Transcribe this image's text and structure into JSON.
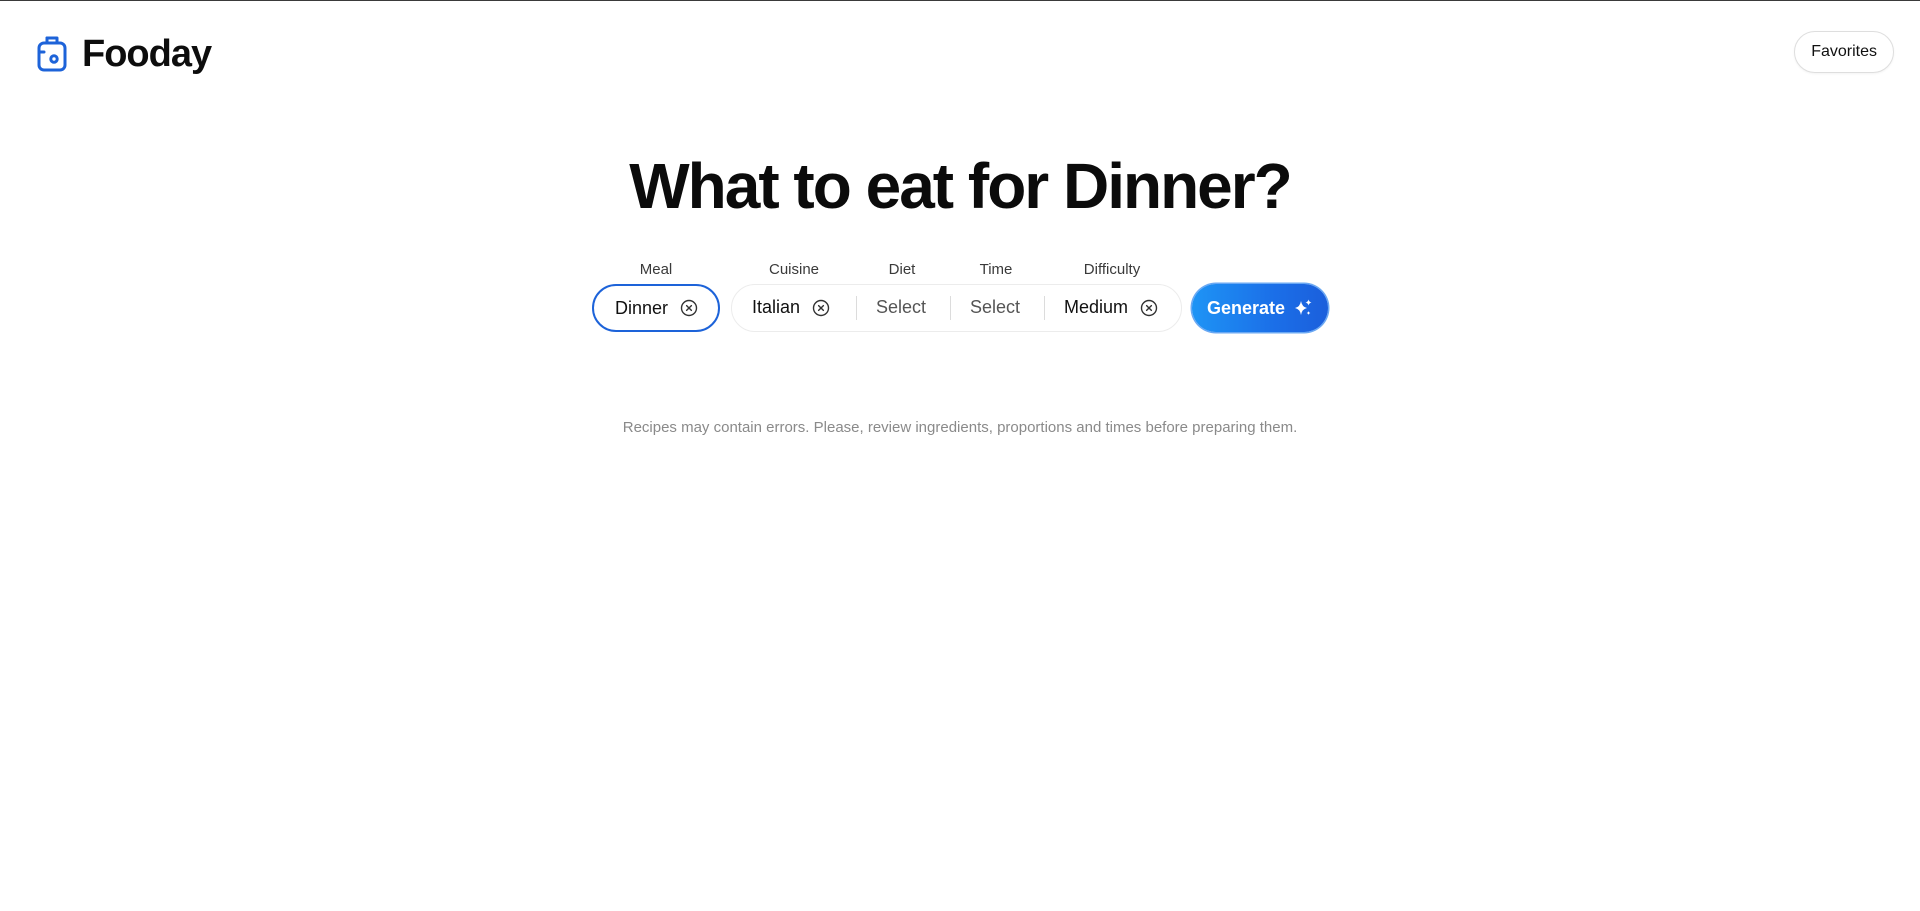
{
  "brand": {
    "name": "Fooday",
    "icon": "fridge-icon",
    "accent": "#1d63d9"
  },
  "header": {
    "favorites_label": "Favorites"
  },
  "main": {
    "title": "What to eat for Dinner?"
  },
  "filters": {
    "meal": {
      "label": "Meal",
      "value": "Dinner"
    },
    "cuisine": {
      "label": "Cuisine",
      "value": "Italian"
    },
    "diet": {
      "label": "Diet",
      "placeholder": "Select"
    },
    "time": {
      "label": "Time",
      "placeholder": "Select"
    },
    "difficulty": {
      "label": "Difficulty",
      "value": "Medium"
    }
  },
  "generate": {
    "label": "Generate",
    "icon": "sparkle-icon",
    "color": "#1b6fe8"
  },
  "disclaimer": "Recipes may contain errors. Please, review ingredients, proportions and times before preparing them."
}
